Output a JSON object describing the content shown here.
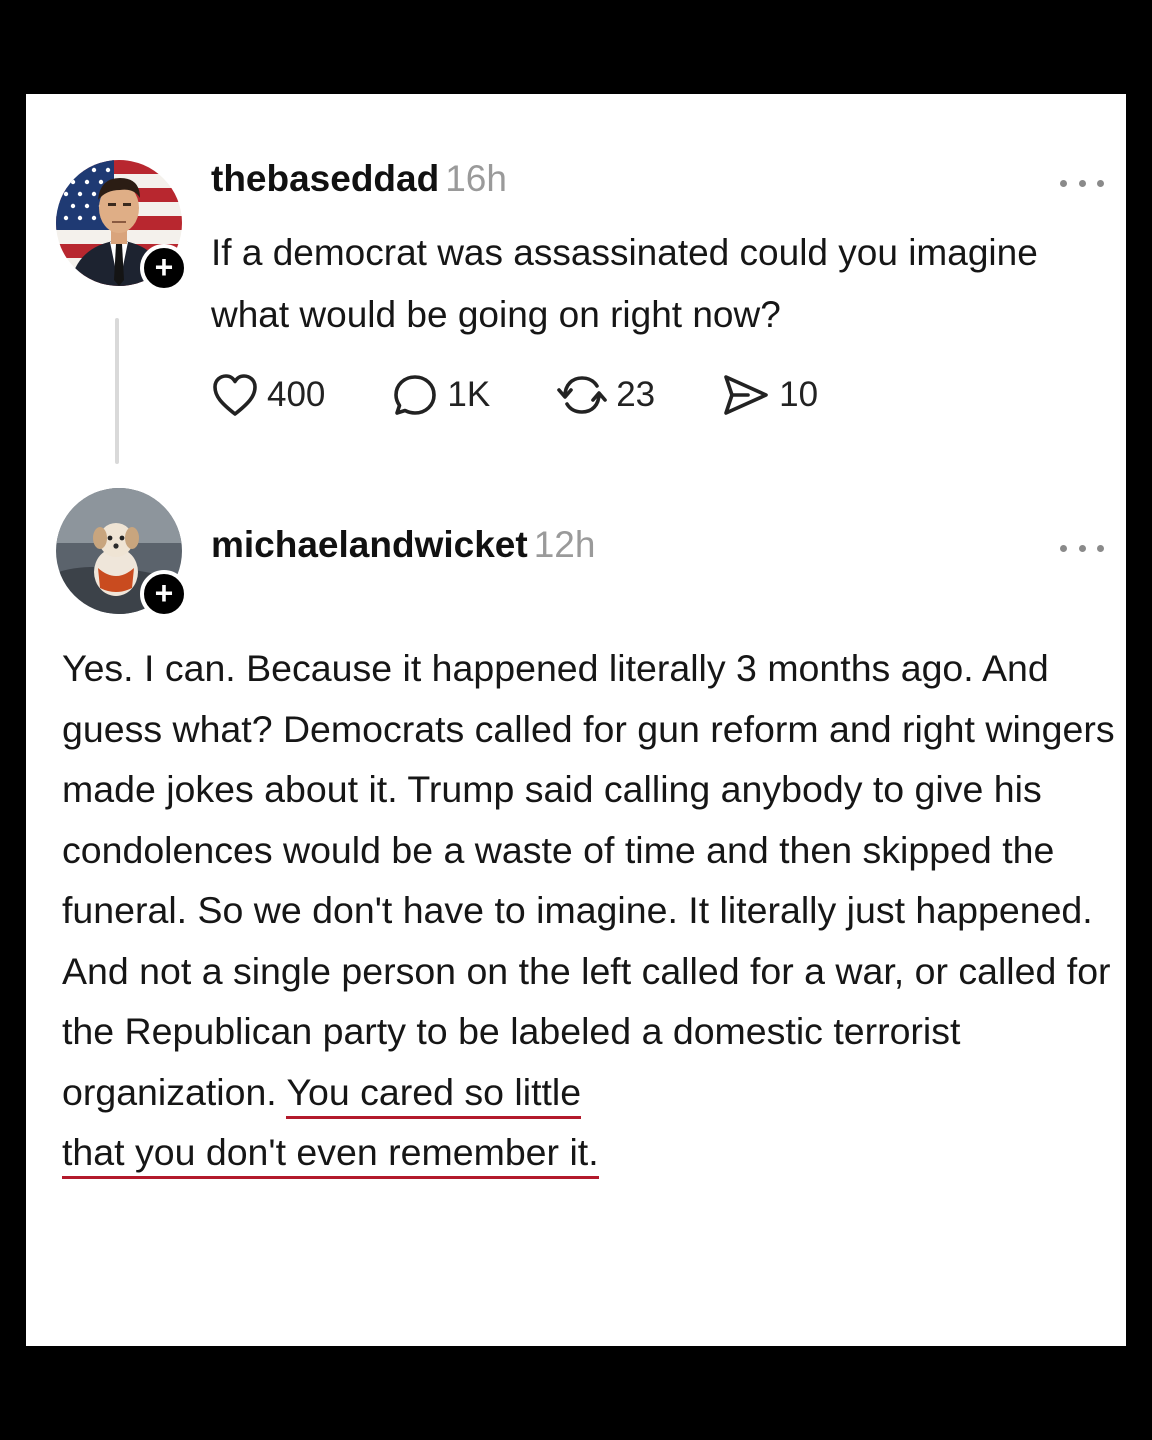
{
  "post": {
    "username": "thebaseddad",
    "time": "16h",
    "text": "If a democrat was assassinated could you imagine what would be going on right now?",
    "actions": {
      "likes": "400",
      "replies": "1K",
      "reposts": "23",
      "shares": "10"
    },
    "avatar_icon": "avatar-man-flag-icon"
  },
  "reply": {
    "username": "michaelandwicket",
    "time": "12h",
    "avatar_icon": "avatar-dog-icon",
    "text_plain": "Yes. I can. Because it happened literally 3 months ago. And guess what? Democrats called for gun reform and right wingers made jokes about it. Trump said calling anybody to give his condolences would be a waste of time and then skipped the funeral. So we don't have to imagine. It literally just happened. And not a single person on the left called for a war, or called for the Republican party to be labeled a domestic terrorist organization. ",
    "text_highlight_1": "You cared so little",
    "text_highlight_2": "that you don't even remember it."
  },
  "colors": {
    "background": "#000000",
    "card": "#ffffff",
    "underline": "#b3192b",
    "muted": "#9a9a9a"
  },
  "follow_badge": "+"
}
